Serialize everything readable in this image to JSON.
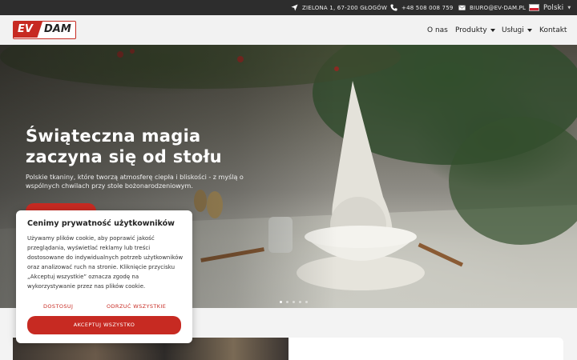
{
  "topbar": {
    "address": "ZIELONA 1, 67-200 GŁOGÓW",
    "phone": "+48 508 008 759",
    "email": "BIURO@EV-DAM.PL",
    "language": "Polski",
    "icons": [
      "location-arrow-icon",
      "phone-icon",
      "envelope-icon",
      "poland-flag-icon"
    ]
  },
  "header": {
    "logo_ev": "EV",
    "logo_dam": "DAM",
    "nav": [
      {
        "label": "O nas"
      },
      {
        "label": "Produkty"
      },
      {
        "label": "Usługi"
      },
      {
        "label": "Kontakt"
      }
    ]
  },
  "hero": {
    "title": "Świąteczna magia zaczyna się od stołu",
    "subtitle": "Polskie tkaniny, które tworzą atmosferę ciepła i bliskości - z myślą o wspólnych chwilach przy stole bożonarodzeniowym."
  },
  "cookie": {
    "title": "Cenimy prywatność użytkowników",
    "body": "Używamy plików cookie, aby poprawić jakość przeglądania, wyświetlać reklamy lub treści dostosowane do indywidualnych potrzeb użytkowników oraz analizować ruch na stronie. Kliknięcie przycisku „Akceptuj wszystkie” oznacza zgodę na wykorzystywanie przez nas plików cookie.",
    "customize_label": "DOSTOSUJ",
    "reject_label": "ODRZUĆ WSZYSTKIE",
    "accept_label": "AKCEPTUJ WSZYSTKO"
  },
  "colors": {
    "brand_red": "#c72a22",
    "topbar_bg": "#2d2d2d",
    "header_bg": "#f2f2f2"
  }
}
